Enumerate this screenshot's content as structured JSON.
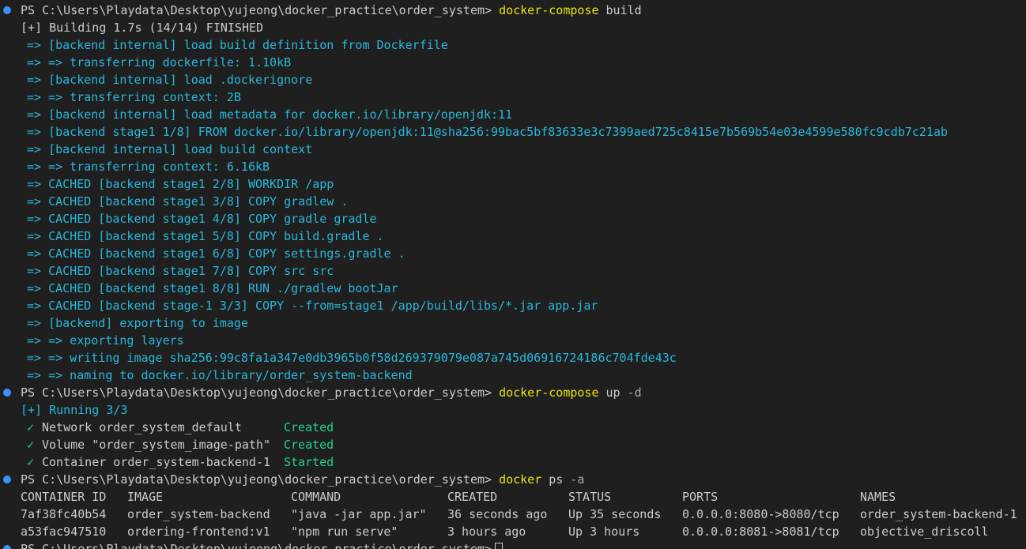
{
  "prompt": "PS C:\\Users\\Playdata\\Desktop\\yujeong\\docker_practice\\order_system>",
  "commands": {
    "build": {
      "cmd": "docker-compose",
      "args": " build"
    },
    "up": {
      "cmd": "docker-compose",
      "args": " up",
      "flag": " -d"
    },
    "ps": {
      "cmd": "docker",
      "args": " ps",
      "flag": " -a"
    }
  },
  "build_output": {
    "header": "[+] Building 1.7s (14/14) FINISHED",
    "steps": [
      "=> [backend internal] load build definition from Dockerfile",
      "=> => transferring dockerfile: 1.10kB",
      "=> [backend internal] load .dockerignore",
      "=> => transferring context: 2B",
      "=> [backend internal] load metadata for docker.io/library/openjdk:11",
      "=> [backend stage1 1/8] FROM docker.io/library/openjdk:11@sha256:99bac5bf83633e3c7399aed725c8415e7b569b54e03e4599e580fc9cdb7c21ab",
      "=> [backend internal] load build context",
      "=> => transferring context: 6.16kB",
      "=> CACHED [backend stage1 2/8] WORKDIR /app",
      "=> CACHED [backend stage1 3/8] COPY gradlew .",
      "=> CACHED [backend stage1 4/8] COPY gradle gradle",
      "=> CACHED [backend stage1 5/8] COPY build.gradle .",
      "=> CACHED [backend stage1 6/8] COPY settings.gradle .",
      "=> CACHED [backend stage1 7/8] COPY src src",
      "=> CACHED [backend stage1 8/8] RUN ./gradlew bootJar",
      "=> CACHED [backend stage-1 3/3] COPY --from=stage1 /app/build/libs/*.jar app.jar",
      "=> [backend] exporting to image",
      "=> => exporting layers",
      "=> => writing image sha256:99c8fa1a347e0db3965b0f58d269379079e087a745d06916724186c704fde43c",
      "=> => naming to docker.io/library/order_system-backend"
    ]
  },
  "up_output": {
    "header": "[+] Running 3/3",
    "items": [
      {
        "check": "✓",
        "label": "Network order_system_default",
        "status": "Created"
      },
      {
        "check": "✓",
        "label": "Volume \"order_system_image-path\"",
        "status": "Created"
      },
      {
        "check": "✓",
        "label": "Container order_system-backend-1",
        "status": "Started"
      }
    ]
  },
  "ps_output": {
    "headers": [
      "CONTAINER ID",
      "IMAGE",
      "COMMAND",
      "CREATED",
      "STATUS",
      "PORTS",
      "NAMES"
    ],
    "rows": [
      [
        "7af38fc40b54",
        "order_system-backend",
        "\"java -jar app.jar\"",
        "36 seconds ago",
        "Up 35 seconds",
        "0.0.0.0:8080->8080/tcp",
        "order_system-backend-1"
      ],
      [
        "a53fac947510",
        "ordering-frontend:v1",
        "\"npm run serve\"",
        "3 hours ago",
        "Up 3 hours",
        "0.0.0.0:8081->8081/tcp",
        "objective_driscoll"
      ]
    ]
  },
  "colors": {
    "background": "#1f1f1f",
    "text": "#cccccc",
    "command": "#e5e510",
    "build_step": "#29b8db",
    "success": "#23d18b",
    "prompt_dot": "#3794ff"
  }
}
